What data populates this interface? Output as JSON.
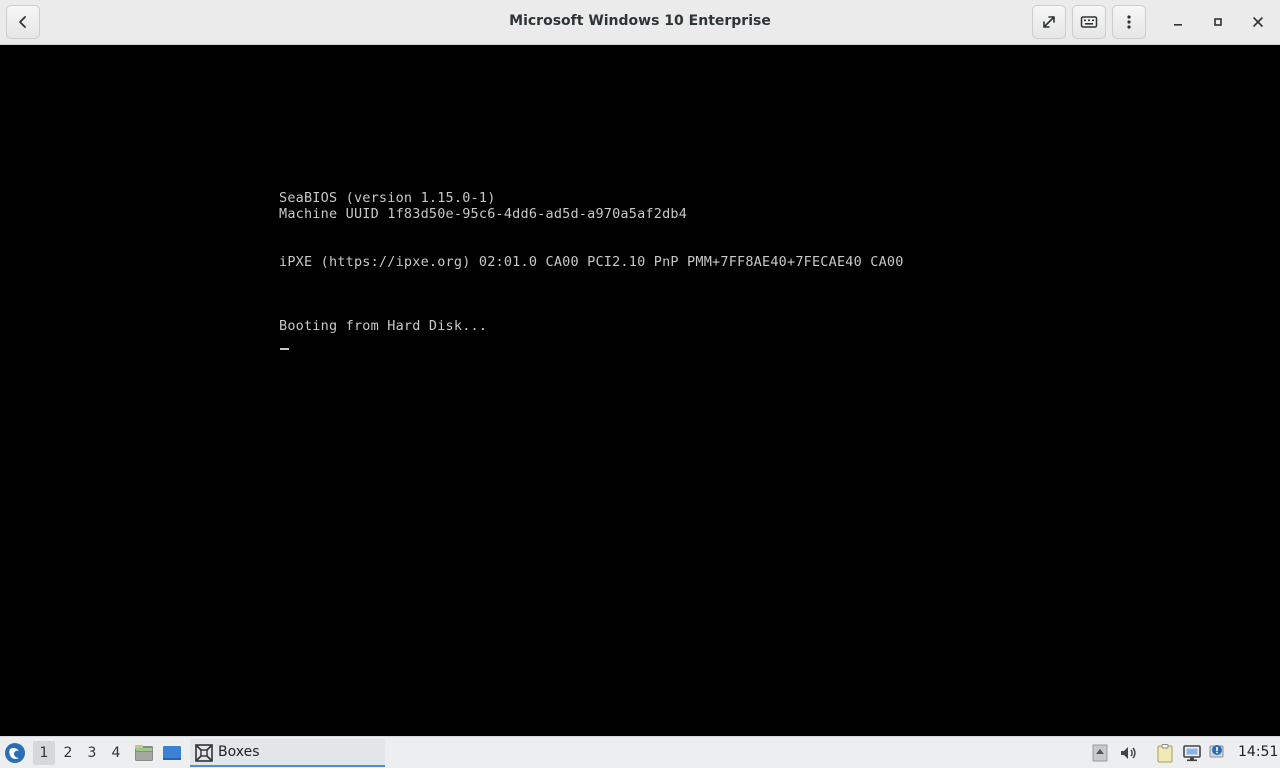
{
  "window": {
    "title": "Microsoft Windows 10 Enterprise"
  },
  "console": {
    "lines": [
      "SeaBIOS (version 1.15.0-1)",
      "Machine UUID 1f83d50e-95c6-4dd6-ad5d-a970a5af2db4",
      "iPXE (https://ipxe.org) 02:01.0 CA00 PCI2.10 PnP PMM+7FF8AE40+7FECAE40 CA00",
      "Booting from Hard Disk..."
    ]
  },
  "taskbar": {
    "workspaces": [
      "1",
      "2",
      "3",
      "4"
    ],
    "active_workspace": "1",
    "task_label": "Boxes",
    "clock": "14:51"
  },
  "colors": {
    "headerbar": "#ebebeb",
    "console_bg": "#000000",
    "console_text": "#c8c8c8",
    "taskbar": "#eceeef",
    "accent": "#4a90d9"
  },
  "icons": {
    "back": "go-back-icon",
    "fullscreen": "fullscreen-icon",
    "keyboard": "keyboard-icon",
    "menu": "kebab-menu-icon",
    "minimize": "minimize-icon",
    "maximize": "maximize-icon",
    "close": "close-icon",
    "start": "start-menu-icon",
    "files": "file-manager-icon",
    "desktop": "show-desktop-icon",
    "boxes": "boxes-app-icon",
    "tray_up": "tray-arrow-icon",
    "volume": "volume-icon",
    "clipboard": "clipboard-icon",
    "network": "network-icon",
    "notification": "notification-icon"
  }
}
